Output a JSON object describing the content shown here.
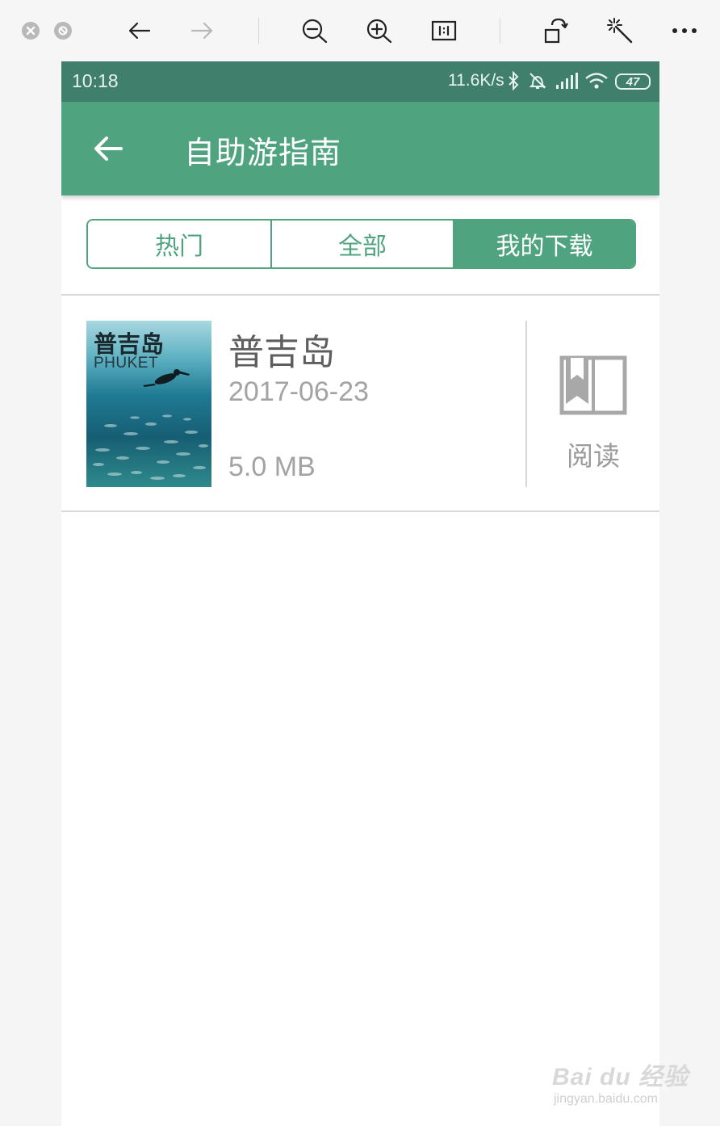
{
  "viewer_toolbar": {
    "icons": [
      "close-icon",
      "disable-icon",
      "arrow-left-icon",
      "arrow-right-icon",
      "zoom-out-icon",
      "zoom-in-icon",
      "actual-size-icon",
      "rotate-icon",
      "magic-wand-icon",
      "more-icon"
    ]
  },
  "status_bar": {
    "time": "10:18",
    "net_speed": "11.6K/s",
    "battery": "47"
  },
  "app_bar": {
    "title": "自助游指南"
  },
  "tabs": [
    {
      "label": "热门",
      "active": false
    },
    {
      "label": "全部",
      "active": false
    },
    {
      "label": "我的下载",
      "active": true
    }
  ],
  "downloads": [
    {
      "cover_title": "普吉岛",
      "cover_subtitle": "PHUKET",
      "name": "普吉岛",
      "date": "2017-06-23",
      "size": "5.0 MB",
      "action_label": "阅读"
    }
  ],
  "watermark": {
    "brand": "Bai du 经验",
    "url": "jingyan.baidu.com"
  },
  "colors": {
    "accent": "#4fa47f",
    "status_bar": "#3f7f6c"
  }
}
